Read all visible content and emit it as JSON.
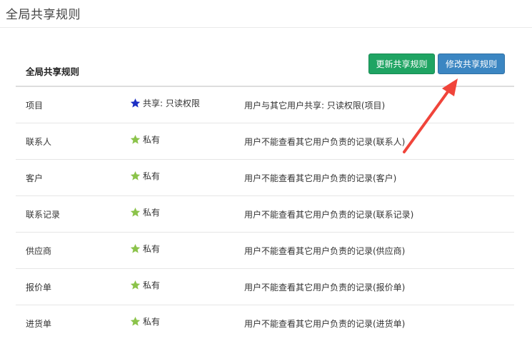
{
  "page": {
    "title": "全局共享规则"
  },
  "panel": {
    "heading": "全局共享规则",
    "update_button": "更新共享规则",
    "modify_button": "修改共享规则"
  },
  "colors": {
    "update_button": "#1fa463",
    "modify_button": "#3b86c2",
    "star_shared": "#1c2fc4",
    "star_private": "#8bc34a",
    "arrow": "#f0443a"
  },
  "rows": [
    {
      "item": "项目",
      "share_icon": "star-blue-icon",
      "share": "共享: 只读权限",
      "desc": "用户与其它用户共享: 只读权限(项目)"
    },
    {
      "item": "联系人",
      "share_icon": "star-green-icon",
      "share": "私有",
      "desc": "用户不能查看其它用户负责的记录(联系人)"
    },
    {
      "item": "客户",
      "share_icon": "star-green-icon",
      "share": "私有",
      "desc": "用户不能查看其它用户负责的记录(客户)"
    },
    {
      "item": "联系记录",
      "share_icon": "star-green-icon",
      "share": "私有",
      "desc": "用户不能查看其它用户负责的记录(联系记录)"
    },
    {
      "item": "供应商",
      "share_icon": "star-green-icon",
      "share": "私有",
      "desc": "用户不能查看其它用户负责的记录(供应商)"
    },
    {
      "item": "报价单",
      "share_icon": "star-green-icon",
      "share": "私有",
      "desc": "用户不能查看其它用户负责的记录(报价单)"
    },
    {
      "item": "进货单",
      "share_icon": "star-green-icon",
      "share": "私有",
      "desc": "用户不能查看其它用户负责的记录(进货单)"
    }
  ]
}
